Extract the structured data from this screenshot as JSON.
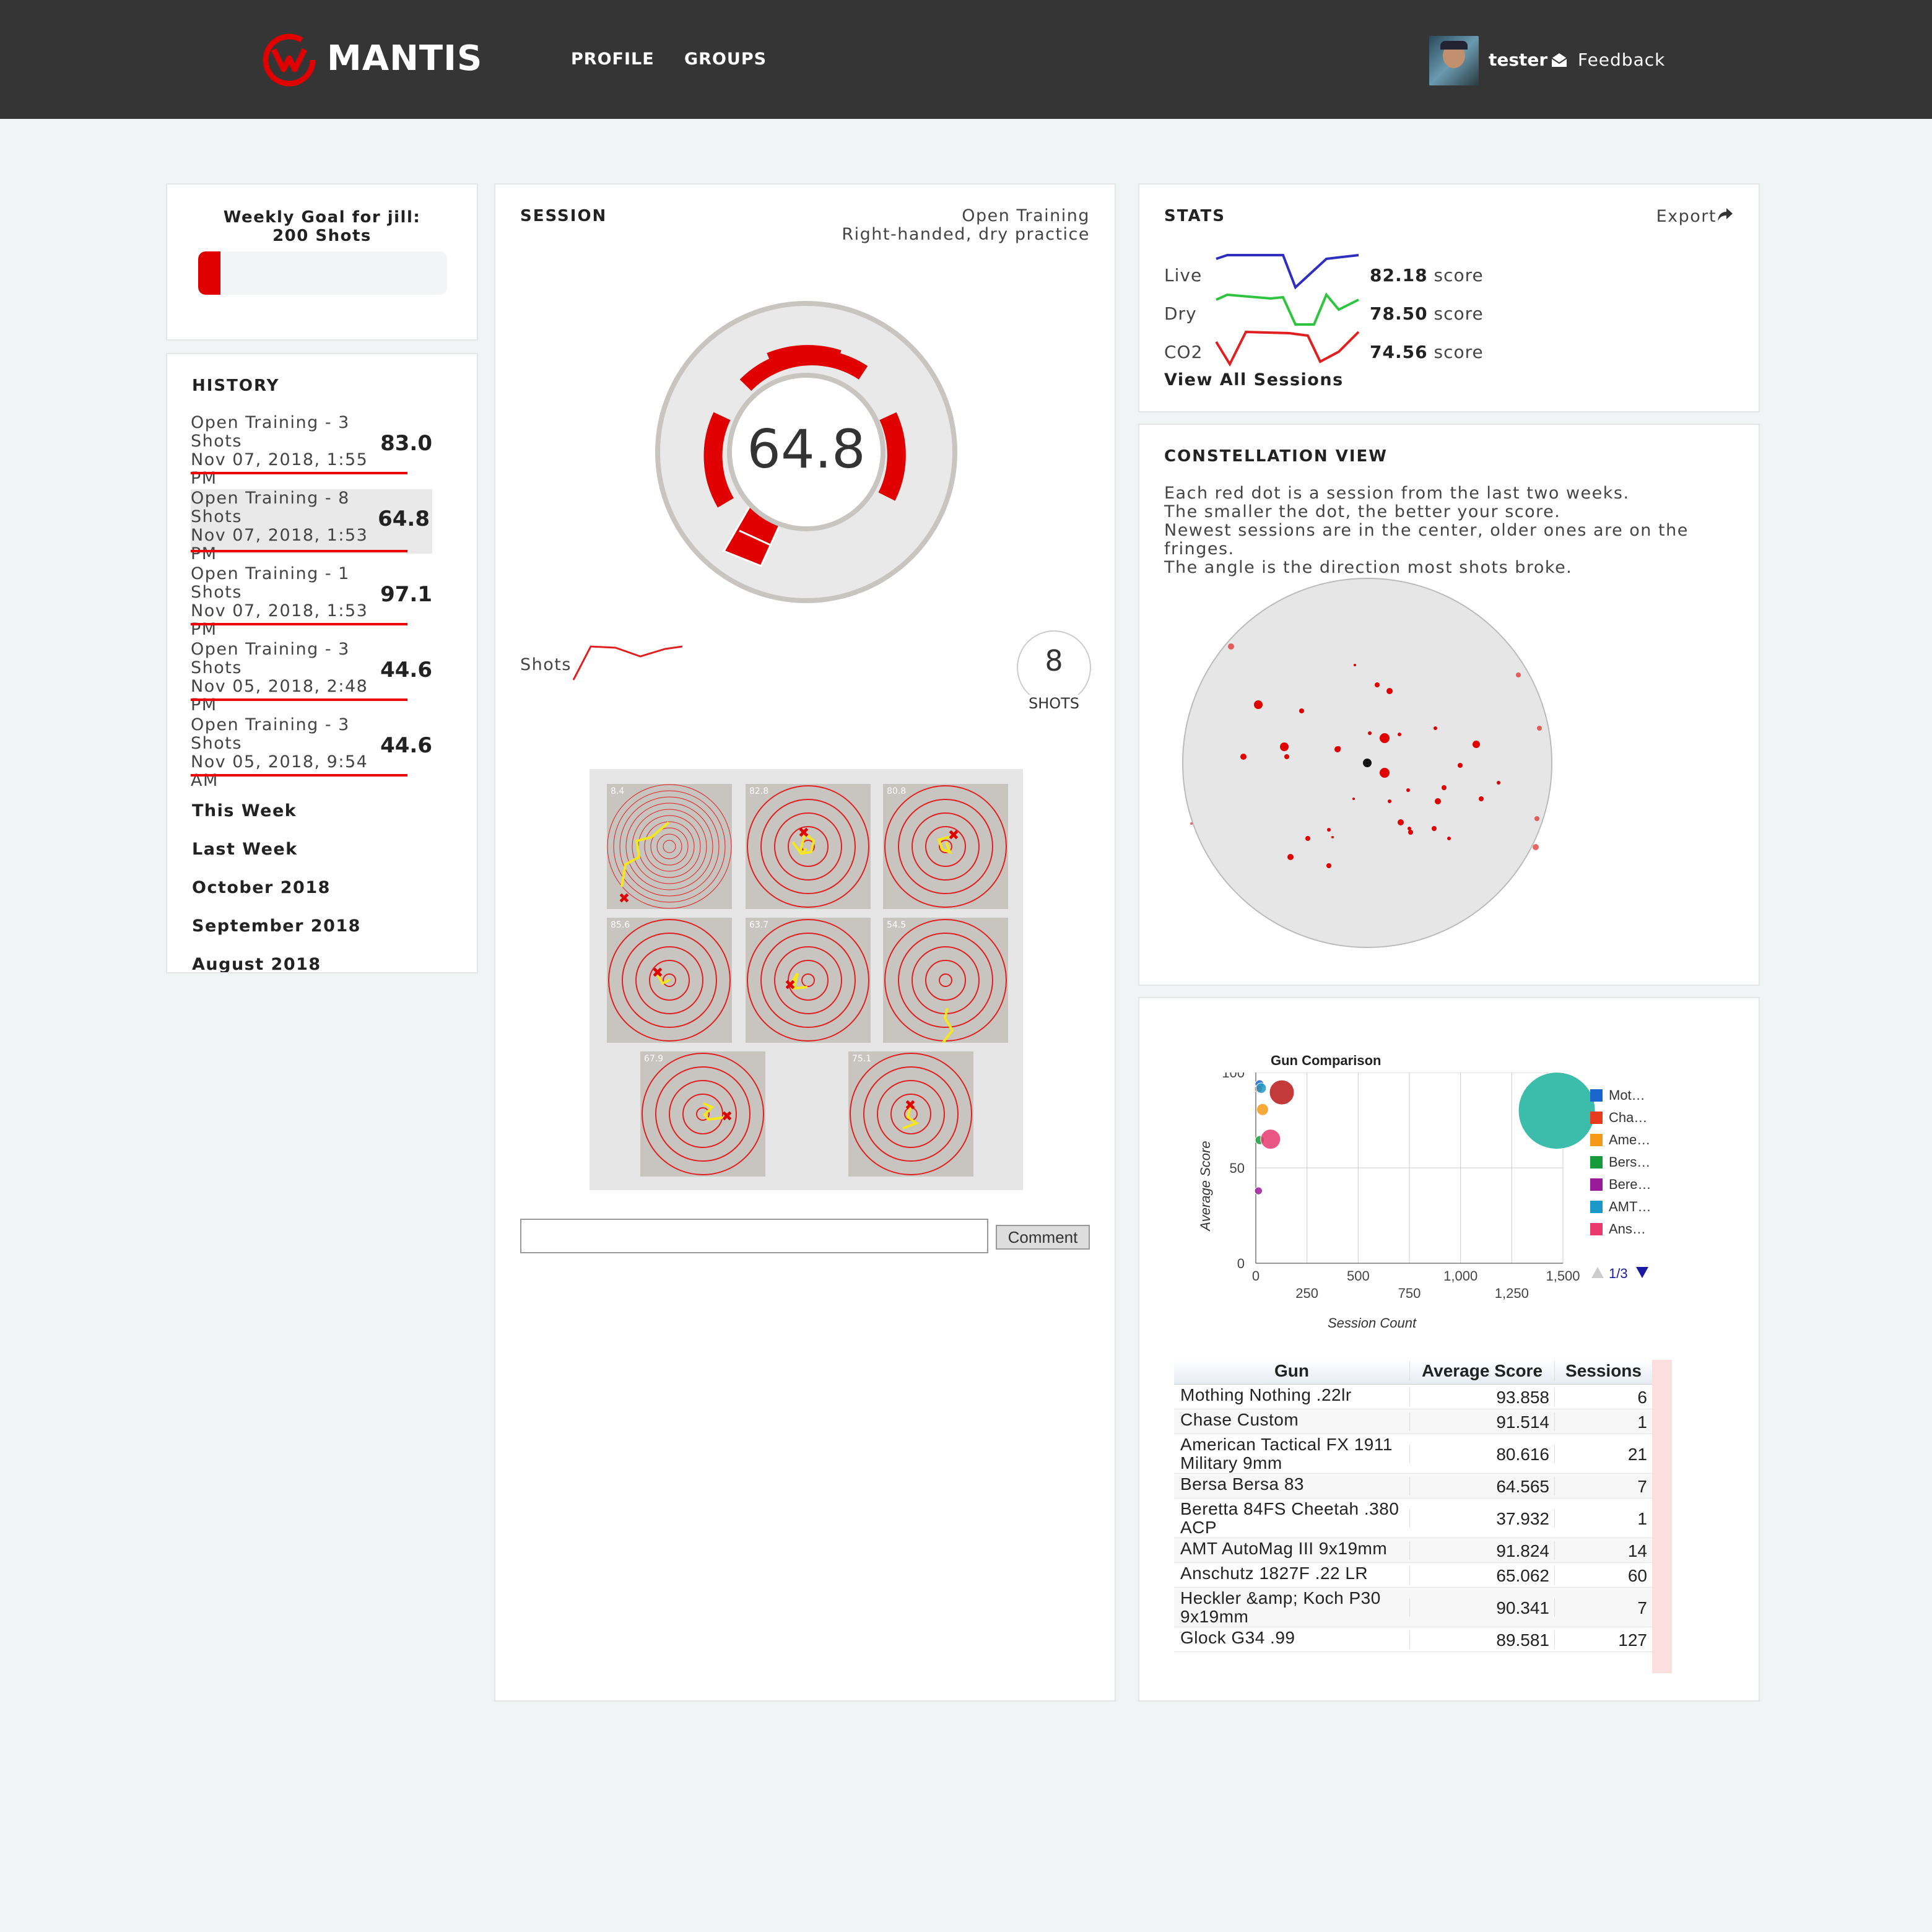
{
  "header": {
    "brand": "MANTIS",
    "nav": [
      "PROFILE",
      "GROUPS"
    ],
    "user": "tester",
    "feedback": "Feedback"
  },
  "goal": {
    "line1": "Weekly Goal for jill:",
    "line2": "200 Shots",
    "progress": 0.09,
    "accent": "#e00000"
  },
  "history": {
    "title": "HISTORY",
    "items": [
      {
        "line1": "Open Training - 3",
        "line2": "Shots",
        "date": "Nov 07, 2018, 1:55 PM",
        "score": "83.0"
      },
      {
        "line1": "Open Training - 8",
        "line2": "Shots",
        "date": "Nov 07, 2018, 1:53 PM",
        "score": "64.8"
      },
      {
        "line1": "Open Training - 1",
        "line2": "Shots",
        "date": "Nov 07, 2018, 1:53 PM",
        "score": "97.1"
      },
      {
        "line1": "Open Training - 3",
        "line2": "Shots",
        "date": "Nov 05, 2018, 2:48 PM",
        "score": "44.6"
      },
      {
        "line1": "Open Training - 3",
        "line2": "Shots",
        "date": "Nov 05, 2018, 9:54 AM",
        "score": "44.6"
      }
    ],
    "periods": [
      "This Week",
      "Last Week",
      "October 2018",
      "September 2018",
      "August 2018"
    ]
  },
  "session": {
    "title": "SESSION",
    "type": "Open Training",
    "mode": "Right-handed, dry practice",
    "score": "64.8",
    "shots_label": "Shots",
    "shot_count": "8",
    "shot_count_unit": "SHOTS",
    "targets": [
      {
        "score": "8.4"
      },
      {
        "score": "82.8"
      },
      {
        "score": "80.8"
      },
      {
        "score": "85.6"
      },
      {
        "score": "63.7"
      },
      {
        "score": "54.5"
      },
      {
        "score": "67.9"
      },
      {
        "score": "75.1"
      }
    ],
    "comment_placeholder": "",
    "comment_button": "Comment"
  },
  "stats": {
    "title": "STATS",
    "export": "Export",
    "rows": [
      {
        "label": "Live",
        "score": "82.18",
        "unit": "score",
        "color": "#2e2ebf"
      },
      {
        "label": "Dry",
        "score": "78.50",
        "unit": "score",
        "color": "#2ec43e"
      },
      {
        "label": "CO2",
        "score": "74.56",
        "unit": "score",
        "color": "#e02020"
      }
    ],
    "view_all": "View All Sessions"
  },
  "constellation": {
    "title": "CONSTELLATION VIEW",
    "lines": [
      "Each red dot is a session from the last two weeks.",
      "The smaller the dot, the better your score.",
      "Newest sessions are in the center, older ones are on the fringes.",
      "The angle is the direction most shots broke."
    ]
  },
  "chart_data": {
    "type": "scatter",
    "title": "Gun Comparison",
    "xlabel": "Session Count",
    "ylabel": "Average Score",
    "xlim": [
      0,
      1500
    ],
    "ylim": [
      0,
      100
    ],
    "xticks": [
      "0",
      "250",
      "500",
      "750",
      "1,000",
      "1,250",
      "1,500"
    ],
    "yticks": [
      "0",
      "50",
      "100"
    ],
    "legend_page": "1/3",
    "series": [
      {
        "name": "Mot…",
        "color": "#1a66cc",
        "x": [
          6
        ],
        "y": [
          93.858
        ]
      },
      {
        "name": "Cha…",
        "color": "#e83a1e",
        "x": [
          1
        ],
        "y": [
          91.514
        ]
      },
      {
        "name": "Ame…",
        "color": "#f59a17",
        "x": [
          21
        ],
        "y": [
          80.616
        ]
      },
      {
        "name": "Bers…",
        "color": "#179a3a",
        "x": [
          7
        ],
        "y": [
          64.565
        ]
      },
      {
        "name": "Bere…",
        "color": "#9a1a9a",
        "x": [
          1
        ],
        "y": [
          37.932
        ]
      },
      {
        "name": "AMT…",
        "color": "#1a99c8",
        "x": [
          14
        ],
        "y": [
          91.824
        ]
      },
      {
        "name": "Ans…",
        "color": "#e83a6e",
        "x": [
          60
        ],
        "y": [
          65.062
        ]
      }
    ],
    "extra_points": [
      {
        "x": 1470,
        "y": 80,
        "color": "#3cbcaa"
      },
      {
        "x": 127,
        "y": 89.581,
        "color": "#c43a3a"
      }
    ],
    "table": {
      "headers": [
        "Gun",
        "Average Score",
        "Sessions"
      ],
      "rows": [
        [
          "Mothing Nothing .22lr",
          "93.858",
          "6"
        ],
        [
          "Chase Custom",
          "91.514",
          "1"
        ],
        [
          "American Tactical FX 1911 Military 9mm",
          "80.616",
          "21"
        ],
        [
          "Bersa Bersa 83",
          "64.565",
          "7"
        ],
        [
          "Beretta 84FS Cheetah .380 ACP",
          "37.932",
          "1"
        ],
        [
          "AMT AutoMag III 9x19mm",
          "91.824",
          "14"
        ],
        [
          "Anschutz 1827F .22 LR",
          "65.062",
          "60"
        ],
        [
          "Heckler &amp; Koch P30 9x19mm",
          "90.341",
          "7"
        ],
        [
          "Glock G34 .99",
          "89.581",
          "127"
        ]
      ]
    }
  }
}
